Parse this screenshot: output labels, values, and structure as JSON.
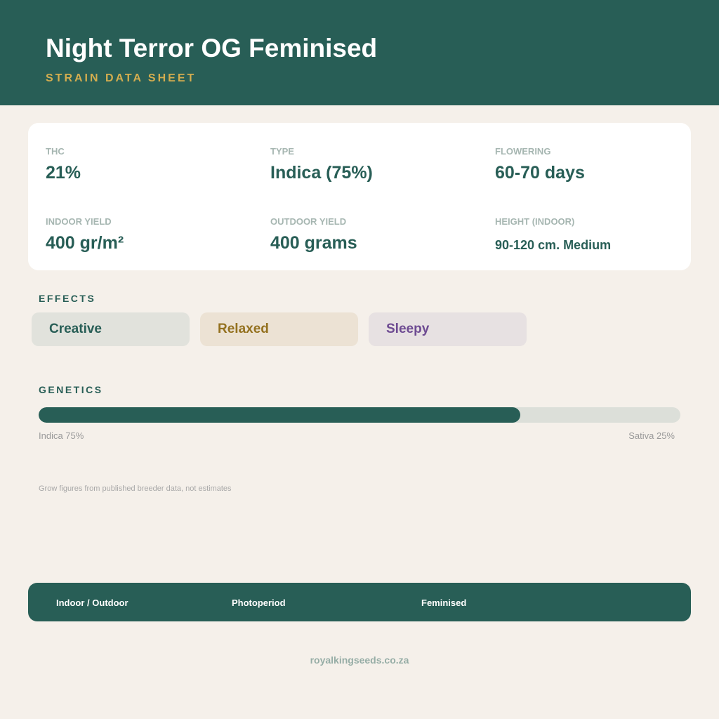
{
  "header": {
    "title": "Night Terror OG Feminised",
    "subtitle": "STRAIN DATA SHEET"
  },
  "stats": {
    "thc": {
      "label": "THC",
      "value": "21%"
    },
    "type": {
      "label": "TYPE",
      "value": "Indica (75%)"
    },
    "flowering": {
      "label": "FLOWERING",
      "value": "60-70 days"
    },
    "indoor_yield": {
      "label": "INDOOR YIELD",
      "value": "400 gr/m²"
    },
    "outdoor_yield": {
      "label": "OUTDOOR YIELD",
      "value": "400 grams"
    },
    "height": {
      "label": "HEIGHT (INDOOR)",
      "value": "90-120 cm. Medium"
    }
  },
  "effects": {
    "heading": "EFFECTS",
    "items": [
      {
        "label": "Creative",
        "text_color": "#285e56",
        "bg_color": "#e1e2dc"
      },
      {
        "label": "Relaxed",
        "text_color": "#94711f",
        "bg_color": "#ece2d4"
      },
      {
        "label": "Sleepy",
        "text_color": "#6e4b92",
        "bg_color": "#e7e1e2"
      }
    ]
  },
  "genetics": {
    "heading": "GENETICS",
    "indica_percent": 75,
    "indica_label": "Indica 75%",
    "sativa_label": "Sativa 25%"
  },
  "note": "Grow figures from published breeder data, not estimates",
  "footer": {
    "items": [
      "Indoor / Outdoor",
      "Photoperiod",
      "Feminised"
    ]
  },
  "site": "royalkingseeds.co.za",
  "colors": {
    "primary": "#285e56",
    "accent": "#d4ad4f",
    "background": "#f5f0ea"
  }
}
